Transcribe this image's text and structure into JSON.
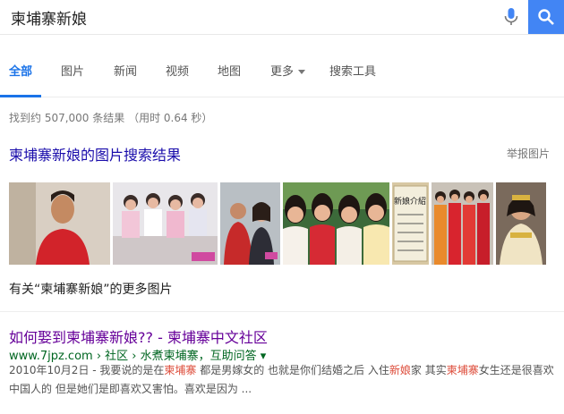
{
  "search": {
    "query": "柬埔寨新娘"
  },
  "tabs": [
    {
      "label": "全部",
      "active": true
    },
    {
      "label": "图片"
    },
    {
      "label": "新闻"
    },
    {
      "label": "视频"
    },
    {
      "label": "地图"
    },
    {
      "label": "更多"
    },
    {
      "label": "搜索工具"
    }
  ],
  "stats": "找到约 507,000 条结果 （用时 0.64 秒）",
  "image_section": {
    "title": "柬埔寨新娘的图片搜索结果",
    "report_label": "举报图片",
    "more_link": "有关“柬埔寨新娘”的更多图片",
    "thumbnails": [
      {
        "icon": "woman-red-dress-photo"
      },
      {
        "icon": "group-women-sitting-photo"
      },
      {
        "icon": "couple-photo"
      },
      {
        "icon": "smiling-women-group-photo"
      },
      {
        "icon": "sign-board-photo",
        "text": "新娘介紹"
      },
      {
        "icon": "women-orange-dress-photo"
      },
      {
        "icon": "bride-photo"
      }
    ]
  },
  "result": {
    "title": "如何娶到柬埔寨新娘?? - 柬埔寨中文社区",
    "url": "www.7jpz.com › 社区 › 水煮柬埔寨，互助问答 ▾",
    "snippet_parts": {
      "a": "2010年10月2日 - 我要说的是在",
      "b": "柬埔寨",
      "c": " 都是男嫁女的 也就是你们结婚之后 入住",
      "d": "新娘",
      "e": "家 其实",
      "f": "柬埔寨",
      "g": "女生还是很喜欢中国人的 但是她们是即喜欢又害怕。喜欢是因为 ..."
    }
  },
  "colors": {
    "accent": "#4285f4",
    "link": "#1a0dab",
    "visited": "#660099",
    "url": "#006621",
    "highlight": "#dd4b39"
  }
}
